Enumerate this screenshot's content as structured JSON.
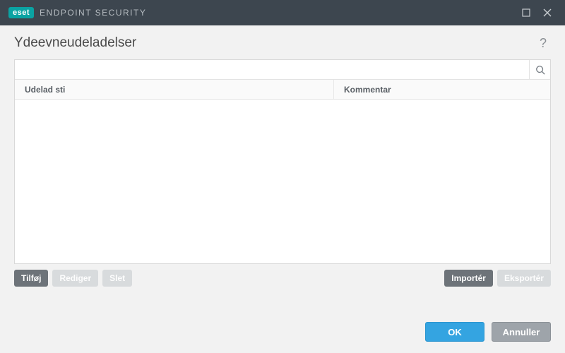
{
  "titlebar": {
    "brand_badge": "eset",
    "brand_name": "ENDPOINT SECURITY"
  },
  "page": {
    "title": "Ydeevneudeladelser"
  },
  "search": {
    "value": ""
  },
  "table": {
    "columns": {
      "path": "Udelad sti",
      "comment": "Kommentar"
    },
    "rows": []
  },
  "actions": {
    "add": "Tilføj",
    "edit": "Rediger",
    "delete": "Slet",
    "import": "Importér",
    "export": "Eksportér"
  },
  "footer": {
    "ok": "OK",
    "cancel": "Annuller"
  }
}
